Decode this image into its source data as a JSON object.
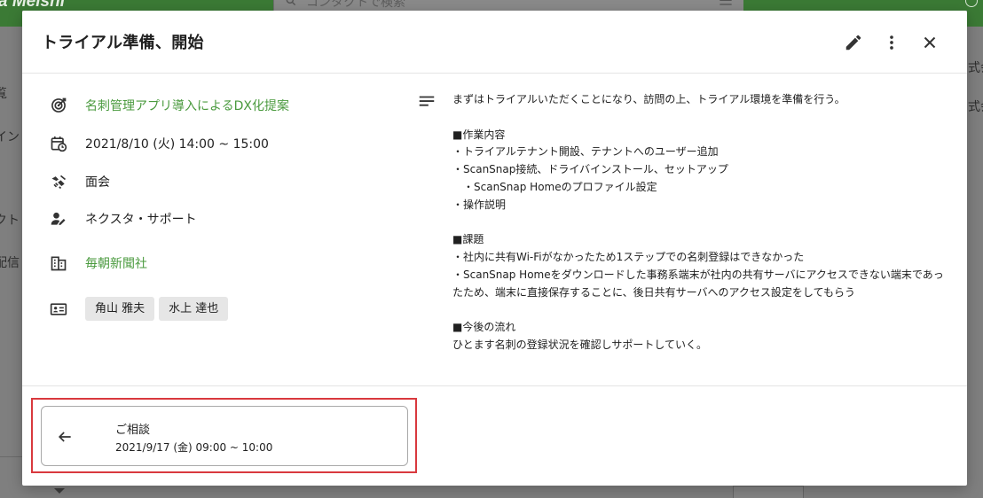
{
  "background": {
    "logo": "a Meishi",
    "search_placeholder": "コンタクトで検索",
    "side_items": [
      "覧",
      "イン",
      "クト",
      "配信"
    ],
    "right_items": [
      "式会",
      "式会"
    ]
  },
  "dialog": {
    "title": "トライアル準備、開始",
    "deal": "名刺管理アプリ導入によるDX化提案",
    "datetime": "2021/8/10 (火) 14:00 ~ 15:00",
    "meeting_type": "面会",
    "owner": "ネクスタ・サポート",
    "company": "毎朝新聞社",
    "contacts": [
      "角山 雅夫",
      "水上 達也"
    ],
    "description": "まずはトライアルいただくことになり、訪問の上、トライアル環境を準備を行う。\n\n■作業内容\n・トライアルテナント開設、テナントへのユーザー追加\n・ScanSnap接続、ドライバインストール、セットアップ\n　・ScanSnap Homeのプロファイル設定\n・操作説明\n\n■課題\n・社内に共有Wi-Fiがなかったため1ステップでの名刺登録はできなかった\n・ScanSnap Homeをダウンロードした事務系端末が社内の共有サーバにアクセスできない端末であったため、端末に直接保存することに、後日共有サーバへのアクセス設定をしてもらう\n\n■今後の流れ\nひとます名刺の登録状況を確認しサポートしていく。",
    "previous": {
      "title": "ご相談",
      "datetime": "2021/9/17 (金) 09:00 ~ 10:00"
    }
  },
  "colors": {
    "brand_green": "#3b7a35",
    "link_green": "#4a9a3e",
    "highlight_red": "#d9393e"
  },
  "icons": {
    "edit": "pencil-icon",
    "more": "more-vert-icon",
    "close": "close-icon",
    "deal": "target-icon",
    "date": "calendar-clock-icon",
    "type": "handshake-icon",
    "owner": "person-edit-icon",
    "company": "building-icon",
    "contacts": "contact-card-icon",
    "description": "notes-icon",
    "previous": "arrow-back-icon"
  }
}
